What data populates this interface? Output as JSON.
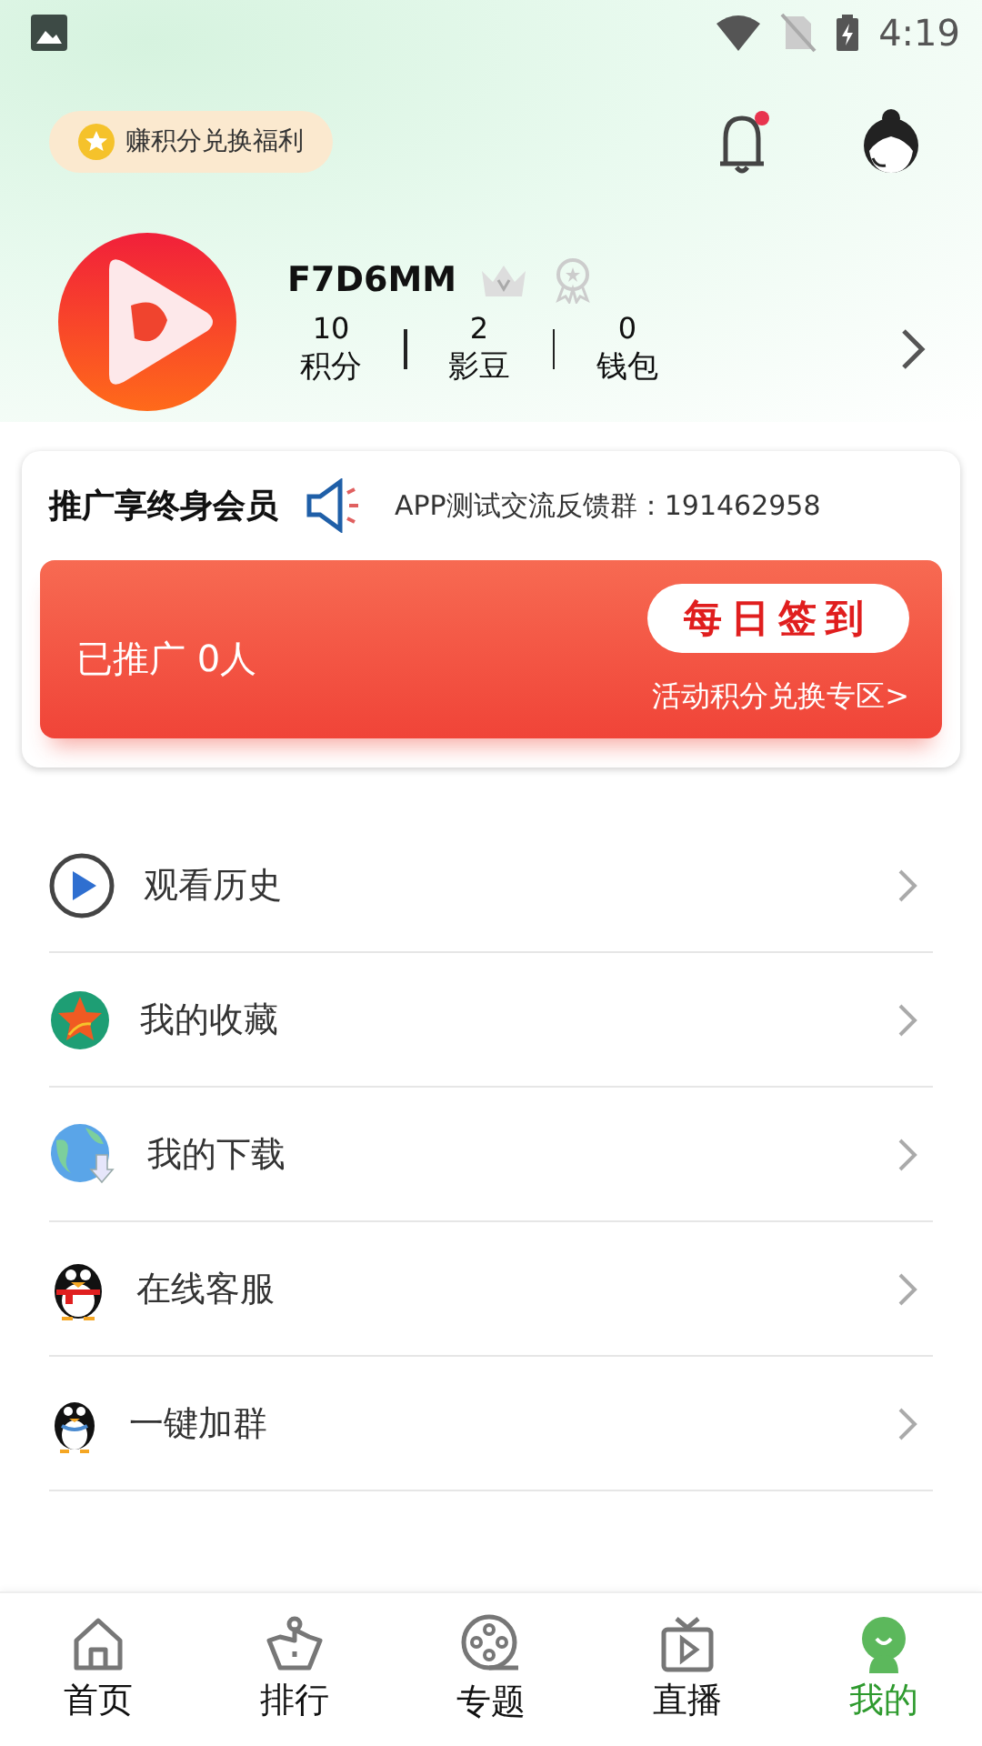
{
  "status_bar": {
    "time": "4:19"
  },
  "header": {
    "points_pill": "赚积分兑换福利"
  },
  "profile": {
    "username": "F7D6MM",
    "stats": [
      {
        "value": "10",
        "label": "积分"
      },
      {
        "value": "2",
        "label": "影豆"
      },
      {
        "value": "0",
        "label": "钱包"
      }
    ]
  },
  "promo": {
    "title": "推广享终身会员",
    "notice": "APP测试交流反馈群：191462958",
    "promoted": "已推广 0人",
    "checkin_button": "每日签到",
    "exchange_link": "活动积分兑换专区>"
  },
  "menu": [
    {
      "kind": "history",
      "label": "观看历史"
    },
    {
      "kind": "favorite",
      "label": "我的收藏"
    },
    {
      "kind": "download",
      "label": "我的下载"
    },
    {
      "kind": "service",
      "label": "在线客服"
    },
    {
      "kind": "group",
      "label": "一键加群"
    }
  ],
  "tabs": [
    {
      "kind": "home",
      "label": "首页",
      "selected": false
    },
    {
      "kind": "rank",
      "label": "排行",
      "selected": false
    },
    {
      "kind": "topic",
      "label": "专题",
      "selected": false
    },
    {
      "kind": "live",
      "label": "直播",
      "selected": false
    },
    {
      "kind": "mine",
      "label": "我的",
      "selected": true
    }
  ]
}
